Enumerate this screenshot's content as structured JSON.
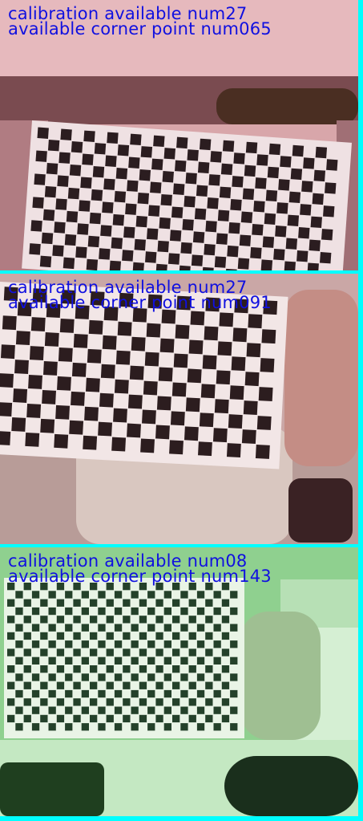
{
  "panels": [
    {
      "id": "panel-1",
      "tint": "#d9a3a8",
      "line1": "calibration available num27",
      "line2": "available corner point num065"
    },
    {
      "id": "panel-2",
      "tint": "#c9a9a9",
      "line1": "calibration available num27",
      "line2": "available corner point num091"
    },
    {
      "id": "panel-3",
      "tint": "#8fcf8f",
      "line1": "calibration available num08",
      "line2": "available corner point num143"
    }
  ],
  "colors": {
    "separator": "#00ffff",
    "overlay_text": "#1010e0"
  }
}
